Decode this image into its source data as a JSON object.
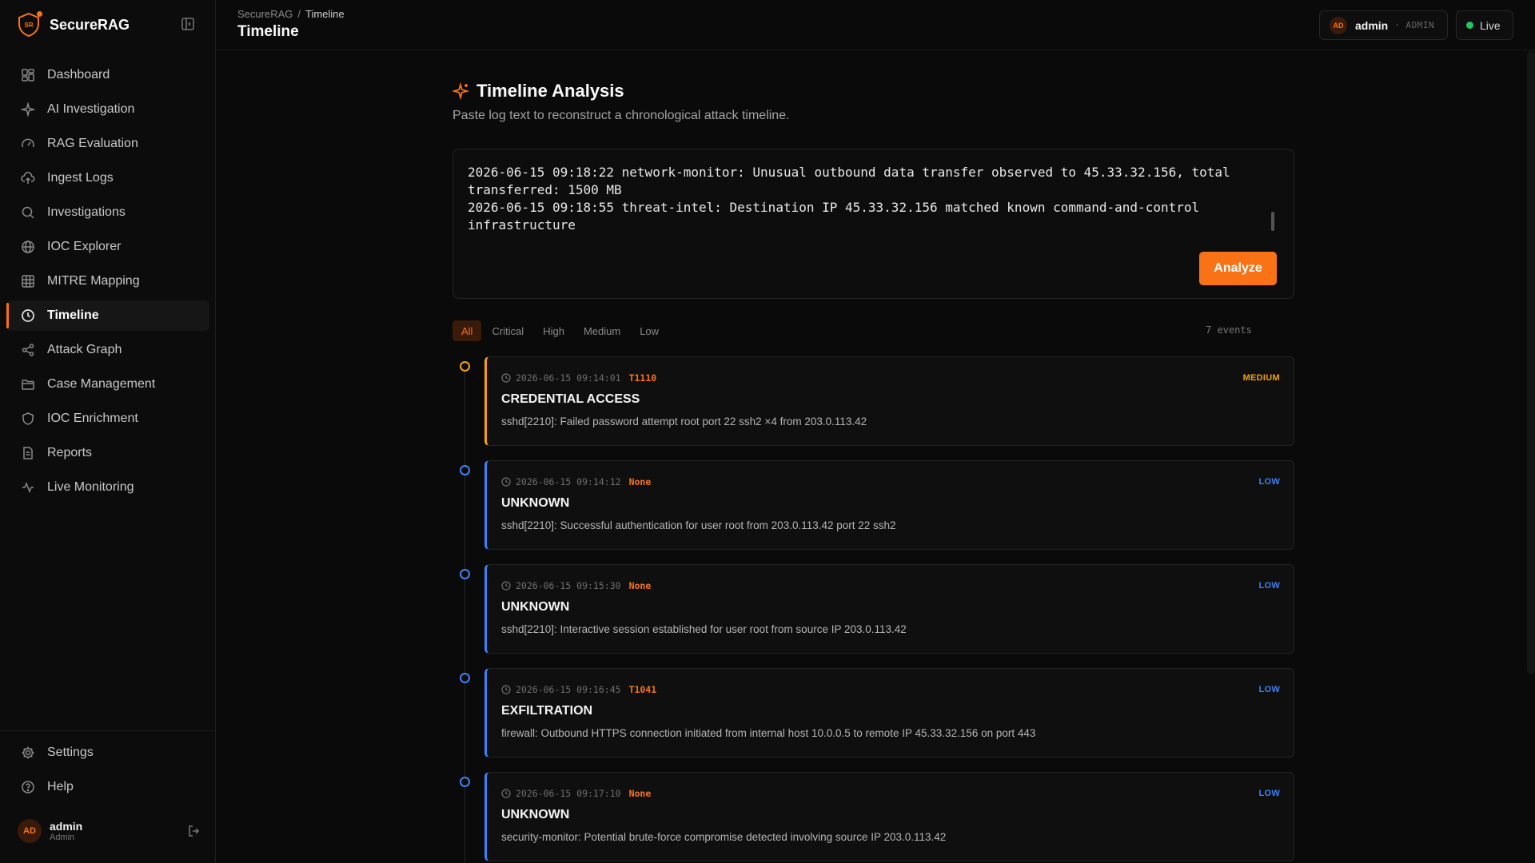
{
  "brand": {
    "logo_text": "SR",
    "name": "SecureRAG"
  },
  "nav": [
    {
      "label": "Dashboard",
      "icon": "dashboard-icon",
      "active": false
    },
    {
      "label": "AI Investigation",
      "icon": "sparkles-icon",
      "active": false
    },
    {
      "label": "RAG Evaluation",
      "icon": "gauge-icon",
      "active": false
    },
    {
      "label": "Ingest Logs",
      "icon": "cloud-upload-icon",
      "active": false
    },
    {
      "label": "Investigations",
      "icon": "search-icon",
      "active": false
    },
    {
      "label": "IOC Explorer",
      "icon": "globe-icon",
      "active": false
    },
    {
      "label": "MITRE Mapping",
      "icon": "grid-icon",
      "active": false
    },
    {
      "label": "Timeline",
      "icon": "clock-icon",
      "active": true
    },
    {
      "label": "Attack Graph",
      "icon": "share-icon",
      "active": false
    },
    {
      "label": "Case Management",
      "icon": "folder-icon",
      "active": false
    },
    {
      "label": "IOC Enrichment",
      "icon": "shield-icon",
      "active": false
    },
    {
      "label": "Reports",
      "icon": "file-text-icon",
      "active": false
    },
    {
      "label": "Live Monitoring",
      "icon": "activity-icon",
      "active": false
    }
  ],
  "sidebar_bottom": [
    {
      "label": "Settings",
      "icon": "gear-icon"
    },
    {
      "label": "Help",
      "icon": "help-circle-icon"
    }
  ],
  "user": {
    "initials": "AD",
    "name": "admin",
    "role": "Admin"
  },
  "header": {
    "breadcrumb_root": "SecureRAG",
    "breadcrumb_sep": "/",
    "breadcrumb_current": "Timeline",
    "title": "Timeline",
    "chip_name": "admin",
    "chip_role": "· ADMIN",
    "live_label": "Live"
  },
  "analysis": {
    "title": "Timeline Analysis",
    "subtitle": "Paste log text to reconstruct a chronological attack timeline.",
    "log_text": "2026-06-15 09:18:22 network-monitor: Unusual outbound data transfer observed to 45.33.32.156, total\ntransferred: 1500 MB\n2026-06-15 09:18:55 threat-intel: Destination IP 45.33.32.156 matched known command-and-control\ninfrastructure",
    "analyze_label": "Analyze"
  },
  "filters": [
    {
      "label": "All",
      "active": true
    },
    {
      "label": "Critical",
      "active": false
    },
    {
      "label": "High",
      "active": false
    },
    {
      "label": "Medium",
      "active": false
    },
    {
      "label": "Low",
      "active": false
    }
  ],
  "event_count": "7 events",
  "colors": {
    "accent": "#f97316",
    "medium": "#f59e0b",
    "low": "#3b82f6",
    "live": "#22c55e"
  },
  "events": [
    {
      "time": "2026-06-15 09:14:01",
      "technique": "T1110",
      "severity": "MEDIUM",
      "title": "CREDENTIAL ACCESS",
      "desc": "sshd[2210]: Failed password attempt root port 22 ssh2 ×4 from 203.0.113.42"
    },
    {
      "time": "2026-06-15 09:14:12",
      "technique": "None",
      "severity": "LOW",
      "title": "UNKNOWN",
      "desc": "sshd[2210]: Successful authentication for user root from 203.0.113.42 port 22 ssh2"
    },
    {
      "time": "2026-06-15 09:15:30",
      "technique": "None",
      "severity": "LOW",
      "title": "UNKNOWN",
      "desc": "sshd[2210]: Interactive session established for user root from source IP 203.0.113.42"
    },
    {
      "time": "2026-06-15 09:16:45",
      "technique": "T1041",
      "severity": "LOW",
      "title": "EXFILTRATION",
      "desc": "firewall: Outbound HTTPS connection initiated from internal host 10.0.0.5 to remote IP 45.33.32.156 on port 443"
    },
    {
      "time": "2026-06-15 09:17:10",
      "technique": "None",
      "severity": "LOW",
      "title": "UNKNOWN",
      "desc": "security-monitor: Potential brute-force compromise detected involving source IP 203.0.113.42"
    }
  ]
}
